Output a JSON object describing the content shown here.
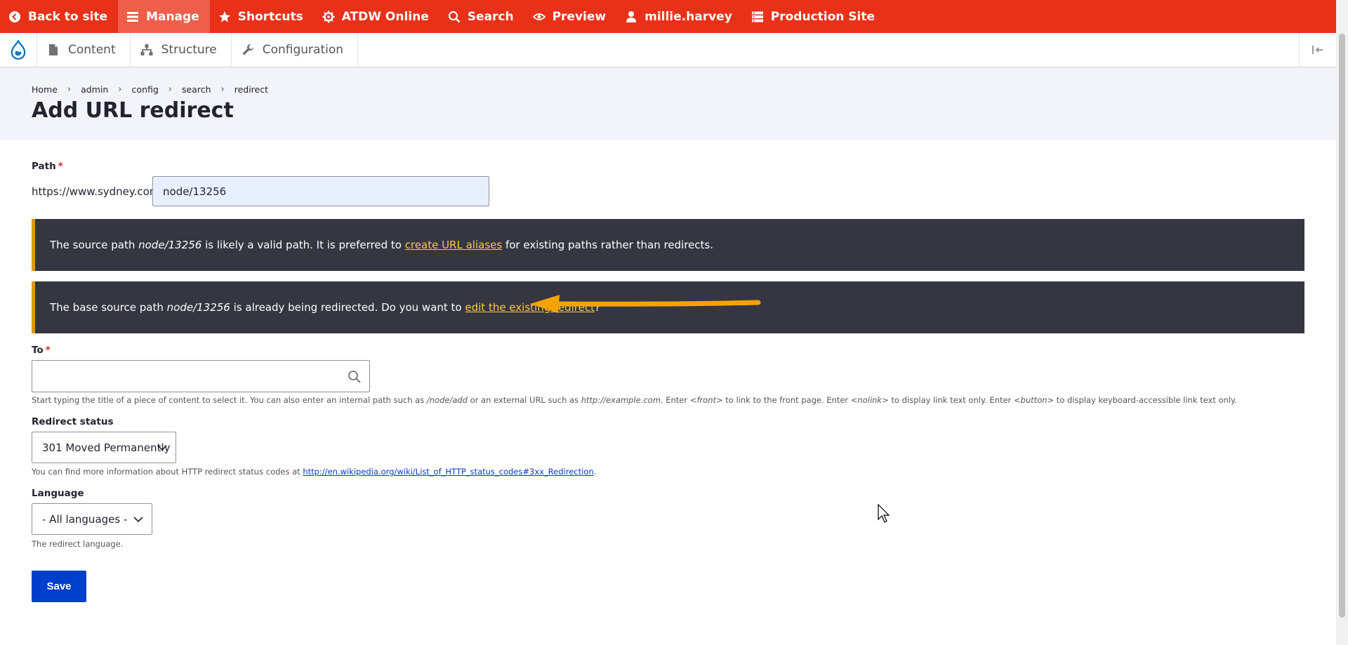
{
  "toolbar": {
    "back_to_site": "Back to site",
    "manage": "Manage",
    "shortcuts": "Shortcuts",
    "atdw_online": "ATDW Online",
    "search": "Search",
    "preview": "Preview",
    "user": "millie.harvey",
    "production_site": "Production Site"
  },
  "tray": {
    "content": "Content",
    "structure": "Structure",
    "configuration": "Configuration"
  },
  "breadcrumb": [
    "Home",
    "admin",
    "config",
    "search",
    "redirect"
  ],
  "page_title": "Add URL redirect",
  "form": {
    "path": {
      "label": "Path",
      "required_mark": "*",
      "prefix": "https://www.sydney.com/",
      "value": "node/13256"
    },
    "messages": [
      {
        "before": "The source path ",
        "em": "node/13256",
        "middle": " is likely a valid path. It is preferred to ",
        "link": "create URL aliases",
        "after": " for existing paths rather than redirects."
      },
      {
        "before": "The base source path ",
        "em": "node/13256",
        "middle": " is already being redirected. Do you want to ",
        "link": "edit the existing redirect",
        "after": "?"
      }
    ],
    "to": {
      "label": "To",
      "required_mark": "*",
      "value": "",
      "description": {
        "t1": "Start typing the title of a piece of content to select it. You can also enter an internal path such as ",
        "e1": "/node/add",
        "t2": " or an external URL such as ",
        "e2": "http://example.com",
        "t3": ". Enter ",
        "e3": "<front>",
        "t4": " to link to the front page. Enter ",
        "e4": "<nolink>",
        "t5": " to display link text only. Enter ",
        "e5": "<button>",
        "t6": " to display keyboard-accessible link text only."
      }
    },
    "redirect_status": {
      "label": "Redirect status",
      "selected": "301 Moved Permanently",
      "description": "You can find more information about HTTP redirect status codes at ",
      "link": "http://en.wikipedia.org/wiki/List_of_HTTP_status_codes#3xx_Redirection",
      "after": "."
    },
    "language": {
      "label": "Language",
      "selected": "- All languages -",
      "description": "The redirect language."
    },
    "save_label": "Save"
  },
  "colors": {
    "toolbar": "#e93119",
    "message_bg": "#353641",
    "message_accent": "#e29700",
    "link_yellow": "#fdca40",
    "primary_button": "#003ecc",
    "arrow": "#f5a300"
  }
}
